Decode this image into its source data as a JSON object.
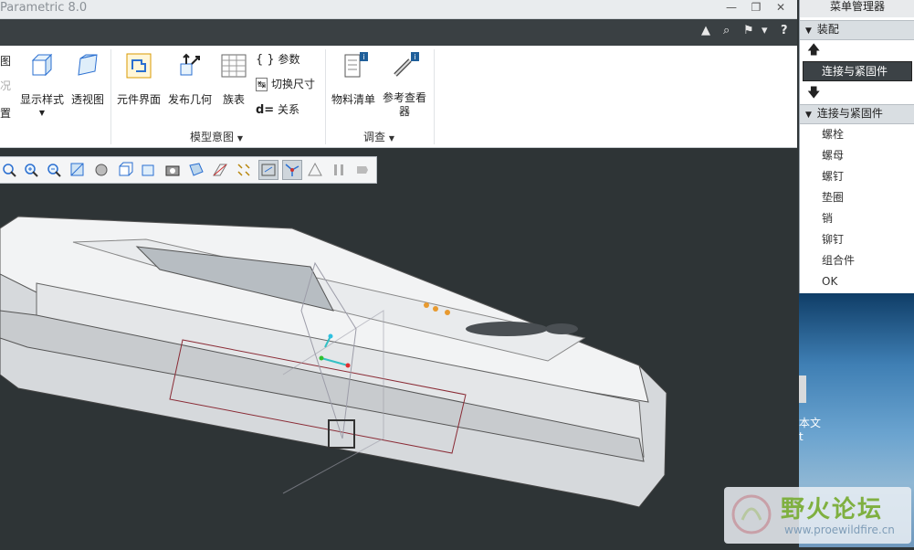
{
  "window": {
    "title": "Parametric 8.0",
    "controls": [
      "—",
      "❐",
      "✕"
    ]
  },
  "tabbar": {
    "icons": [
      "▲",
      "⌕",
      "⚑",
      "▾",
      "?"
    ]
  },
  "ribbon": {
    "left_cut": [
      "图",
      "况",
      "置"
    ],
    "buttons": {
      "display_style": "显示样式",
      "perspective": "透视图",
      "component_interface": "元件界面",
      "publish_geometry": "发布几何",
      "family_table": "族表",
      "parameters": "参数",
      "switch_dimensions": "切换尺寸",
      "relations": "关系",
      "bom": "物料清单",
      "reference_viewer": "参考查看器"
    },
    "groups": {
      "model_intent": "模型意图",
      "investigate": "调查"
    }
  },
  "menu_manager": {
    "title": "菜单管理器",
    "section_assemble": "装配",
    "selected_item": "连接与紧固件",
    "section_connect": "连接与紧固件",
    "items": [
      "螺栓",
      "螺母",
      "螺钉",
      "垫圈",
      "销",
      "铆钉",
      "组合件",
      "OK"
    ]
  },
  "desktop": {
    "text1": "本文",
    "text2": "t"
  },
  "watermark": {
    "cn": "野火论坛",
    "url": "www.proewildfire.cn"
  },
  "colors": {
    "graphics_bg": "#2e3436",
    "ribbon_dark": "#3a4043",
    "accent_blue": "#2a6fd1"
  }
}
